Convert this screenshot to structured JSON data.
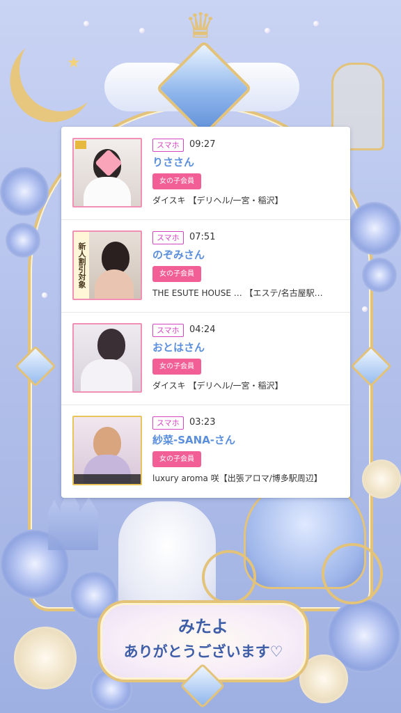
{
  "entries": [
    {
      "tag": "スマホ",
      "time": "09:27",
      "name": "りささん",
      "member": "女の子会員",
      "shop": "ダイスキ 【デリヘル/一宮・稲沢】",
      "thumb_color": "#ede7e3"
    },
    {
      "tag": "スマホ",
      "time": "07:51",
      "name": "のぞみさん",
      "member": "女の子会員",
      "shop": "THE ESUTE HOUSE … 【エステ/名古屋駅…",
      "thumb_badge": "新人割引対象",
      "thumb_color": "#d9cfc6"
    },
    {
      "tag": "スマホ",
      "time": "04:24",
      "name": "おとはさん",
      "member": "女の子会員",
      "shop": "ダイスキ 【デリヘル/一宮・稲沢】",
      "thumb_color": "#e8e4ec"
    },
    {
      "tag": "スマホ",
      "time": "03:23",
      "name": "紗菜-SANA-さん",
      "member": "女の子会員",
      "shop": "luxury aroma 咲【出張アロマ/博多駅周辺】",
      "thumb_color": "#e7dbe6"
    }
  ],
  "plaque": {
    "line1": "みたよ",
    "line2": "ありがとうございます♡"
  }
}
